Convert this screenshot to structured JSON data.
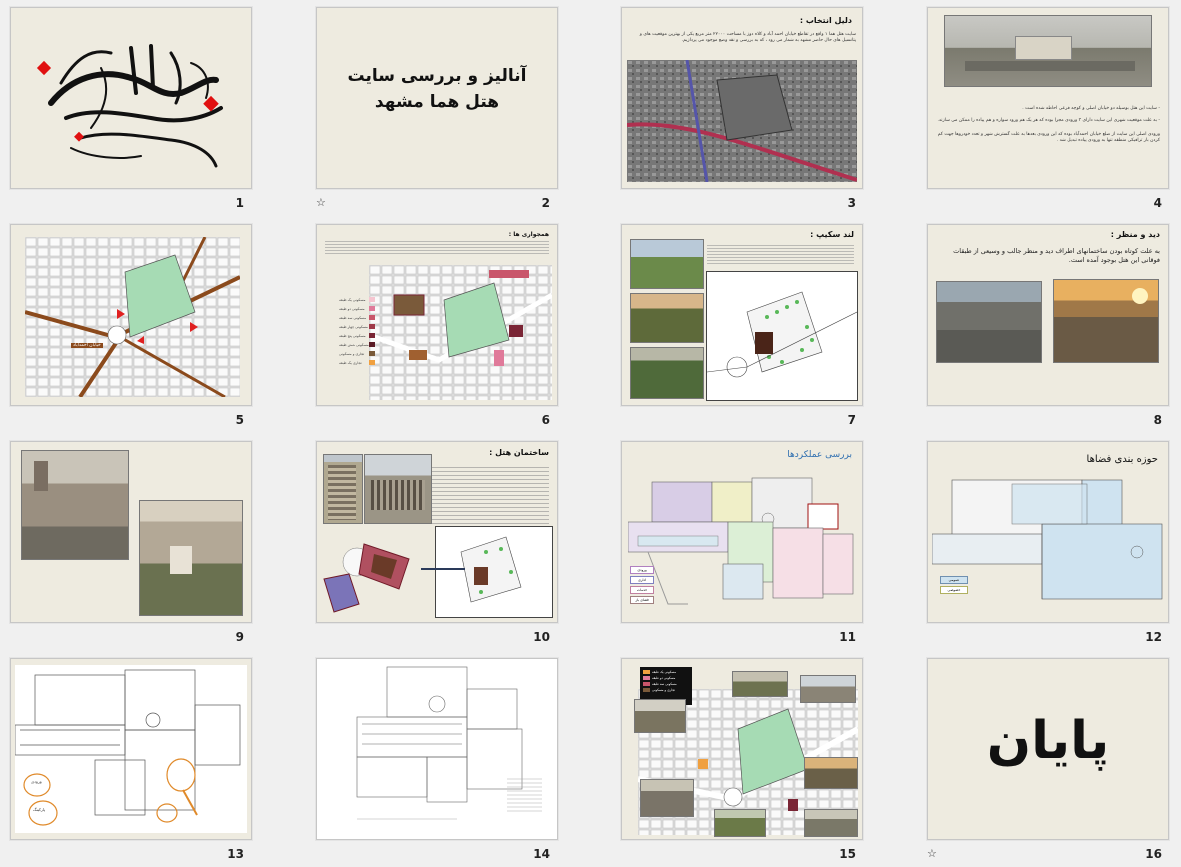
{
  "slides": [
    {
      "num": "1",
      "calligraphy": "بسم الله الرحمن الرحیم"
    },
    {
      "num": "2",
      "title_line1": "آنالیز و بررسی سایت",
      "title_line2": "هتل هما مشهد"
    },
    {
      "num": "3",
      "heading": "دلیل انتخاب :",
      "body": "سایت هتل هما ۱ واقع در تقاطع خیابان احمد آباد و کلاه دوز با مساحت ۲۲۰۰۰ متر مربع یکی از بهترین موقعیت های و پتانسیل های حال حاضر مشهد به شمار می رود ، که به بررسی و نقد وضع موجود می پردازیم."
    },
    {
      "num": "4",
      "bullet1": "- سایت این هتل بوسیله دو خیابان اصلی و کوچه فرعی احاطه شده است .",
      "bullet2": "- به علت موقعیت شهری این سایت دارای ۳ ورودی مجزا بوده که هر یک هم ورود سواره و هم پیاده را ممکن می سازند.",
      "bullet3": "ورودی اصلی این سایت از ضلع خیابان احمدآباد بوده که این ورودی بعدها به علت گسترش شهر و تعدد خودروها جهت کم کردن بار ترافیکی منطقه تنها به ورودی پیاده تبدیل شد ."
    },
    {
      "num": "5",
      "street_label": "خیابان احمدآباد"
    },
    {
      "num": "6",
      "heading": "همجواری ها :",
      "legend": [
        "مسکونی یک طبقه",
        "مسکونی دو طبقه",
        "مسکونی سه طبقه",
        "مسکونی چهار طبقه",
        "مسکونی پنج طبقه",
        "مسکونی شش طبقه",
        "تجاری و مسکونی",
        "تجاری یک طبقه"
      ]
    },
    {
      "num": "7",
      "heading": "لند سکیپ :"
    },
    {
      "num": "8",
      "heading": "دید و منظر :",
      "body": "به علت کوتاه بودن ساختمانهای اطراف دید و منظر جالب و وسیعی از طبقات فوقانی این هتل بوجود آمده است."
    },
    {
      "num": "9"
    },
    {
      "num": "10",
      "heading": "ساختمان هتل :"
    },
    {
      "num": "11",
      "heading": "بررسی عملکردها",
      "legend": [
        "ورودی",
        "اداری",
        "خدمات",
        "فضای باز"
      ]
    },
    {
      "num": "12",
      "heading": "حوزه بندی فضاها",
      "legend": [
        "عمومی",
        "خصوصی"
      ]
    },
    {
      "num": "13",
      "notes": [
        "ورودی",
        "پارکینگ"
      ]
    },
    {
      "num": "14"
    },
    {
      "num": "15",
      "legend": [
        "مسکونی یک طبقه",
        "مسکونی دو طبقه",
        "مسکونی سه طبقه",
        "تجاری و مسکونی"
      ]
    },
    {
      "num": "16",
      "title": "پایان"
    }
  ],
  "star_icon": "☆"
}
